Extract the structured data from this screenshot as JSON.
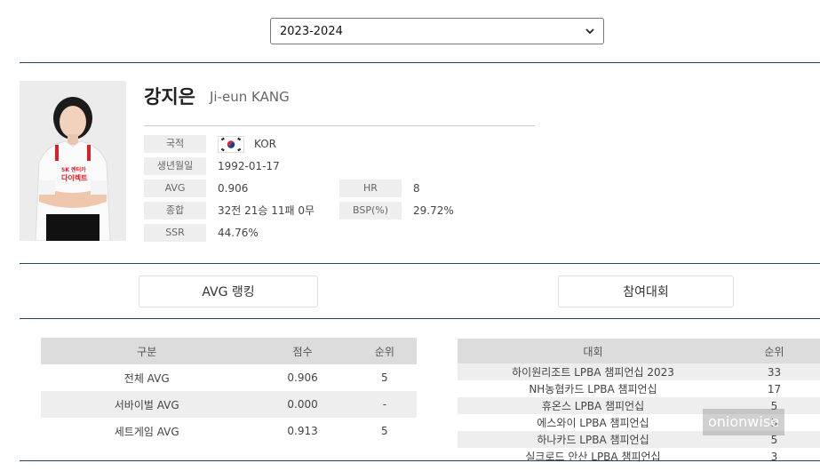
{
  "season": {
    "selected": "2023-2024"
  },
  "player": {
    "name_ko": "강지은",
    "name_en": "Ji-eun KANG",
    "fields": {
      "nationality_label": "국적",
      "nationality_value": "KOR",
      "birth_label": "생년월일",
      "birth_value": "1992-01-17",
      "avg_label": "AVG",
      "avg_value": "0.906",
      "hr_label": "HR",
      "hr_value": "8",
      "record_label": "종합",
      "record_value": "32전 21승 11패 0무",
      "bsp_label": "BSP(%)",
      "bsp_value": "29.72%",
      "ssr_label": "SSR",
      "ssr_value": "44.76%"
    },
    "photo_text": {
      "brand_top": "SK 렌터카",
      "brand_main": "다이렉트"
    }
  },
  "tabs": {
    "avg_ranking": "AVG 랭킹",
    "tournaments": "참여대회"
  },
  "avg_table": {
    "headers": [
      "구분",
      "점수",
      "순위"
    ],
    "rows": [
      [
        "전체 AVG",
        "0.906",
        "5"
      ],
      [
        "서바이벌 AVG",
        "0.000",
        "-"
      ],
      [
        "세트게임 AVG",
        "0.913",
        "5"
      ]
    ]
  },
  "tournament_table": {
    "headers": [
      "대회",
      "순위"
    ],
    "rows": [
      [
        "하이원리조트 LPBA 챔피언십 2023",
        "33"
      ],
      [
        "NH농협카드 LPBA 챔피언십",
        "17"
      ],
      [
        "휴온스 LPBA 챔피언십",
        "5"
      ],
      [
        "에스와이 LPBA 챔피언십",
        "5"
      ],
      [
        "하나카드 LPBA 챔피언십",
        "5"
      ],
      [
        "실크로드 안산 LPBA 챔피언십",
        "3"
      ]
    ]
  },
  "watermark": "onionwise"
}
